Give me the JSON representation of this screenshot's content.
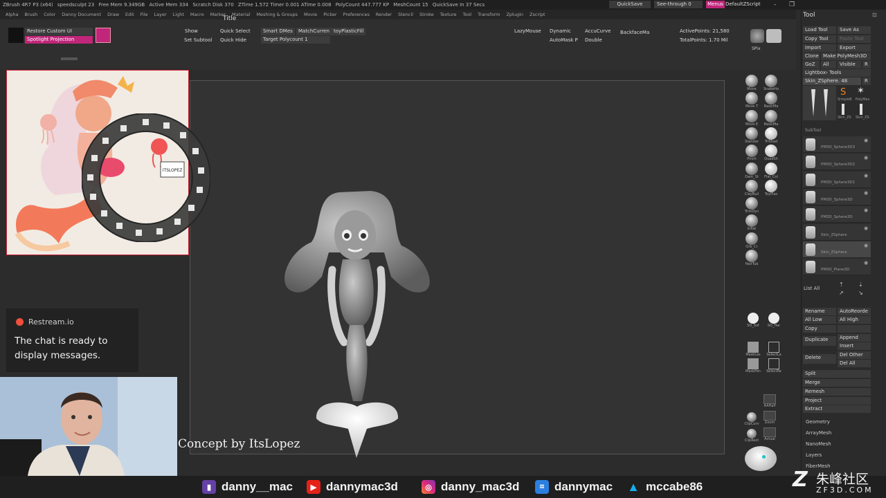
{
  "statusbar": {
    "items": [
      "ZBrush 4R7 P3 (x64)",
      "speedsculpt 23",
      "Free Mem 9.349GB",
      "Active Mem 334",
      "Scratch Disk 370",
      "ZTime 1.572 Timer 0.001 ATime 0.008",
      "PolyCount 447.777 KP",
      "MeshCount 15",
      "QuickSave In 37 Secs"
    ],
    "quicksave": "QuickSave",
    "seethrough": "See-through  0",
    "menus": "Menus",
    "script": "DefaultZScript",
    "window_controls": "- ❐ ✕"
  },
  "menubar": [
    "Alpha",
    "Brush",
    "Color",
    "Danny Document",
    "Draw",
    "Edit",
    "File",
    "Layer",
    "Light",
    "Macro",
    "Marker",
    "Material",
    "Meshing & Groups",
    "Movie",
    "Picker",
    "Preferences",
    "Render",
    "Stencil",
    "Stroke",
    "Texture",
    "Tool",
    "Transform",
    "Zplugin",
    "Zscript"
  ],
  "shelf": {
    "restore": "Restore Custom UI",
    "spotlight": "Spotlight Projection",
    "show": "Show",
    "quick_select": "Quick Select",
    "set_subtool": "Set Subtool",
    "quick_hide": "Quick Hide",
    "smart_dmes": "Smart DMes",
    "match_current": "MatchCurren",
    "toy_plastic": "toyPlasticFill",
    "target_polycount": "Target Polycount 1",
    "lazymouse": "LazyMouse",
    "dynamic": "Dynamic",
    "accucurve": "AccuCurve",
    "backface": "BackfaceMa",
    "automask": "AutoMask P",
    "double": "Double",
    "active_points": "ActivePoints: 21,580",
    "total_points": "TotalPoints: 1.70 Mil",
    "spix": "SPix",
    "title_tip": "Title"
  },
  "right_brushes": [
    {
      "a": "Move",
      "b": "SnakeHo"
    },
    {
      "a": "Move T",
      "b": "BasicMa"
    },
    {
      "a": "Move E",
      "b": "BasicMa"
    },
    {
      "a": "Standar",
      "b": "TriShad"
    },
    {
      "a": "Pinch",
      "b": "QuadSh"
    },
    {
      "a": "Dam_St",
      "b": "Flat_Col"
    },
    {
      "a": "ClayBuil",
      "b": "ToyPlas"
    },
    {
      "a": "TrimDyn",
      "b": ""
    },
    {
      "a": "Inflat",
      "b": ""
    },
    {
      "a": "Orb_Cr",
      "b": ""
    },
    {
      "a": "HairTub",
      "b": ""
    }
  ],
  "right_lower": {
    "so_sof": "SO_Sof",
    "so_har": "SO_Har",
    "masklas": "MaskLas",
    "selectl": "SelectLa",
    "maskpen": "MaskPen",
    "selectr": "SelectRe",
    "aahalf": "AAHalf",
    "clipcurve": "ClipCurv",
    "zoom": "Zoom",
    "cliprect": "ClipRect",
    "actual": "Actual"
  },
  "tool_panel": {
    "title": "Tool",
    "load_tool": "Load Tool",
    "save_as": "Save As",
    "copy_tool": "Copy Tool",
    "paste_tool": "Paste Tool",
    "import": "Import",
    "export": "Export",
    "clone": "Clone",
    "make_polymesh": "Make PolyMesh3D",
    "goz": "GoZ",
    "all": "All",
    "visible": "Visible",
    "r": "R",
    "lightbox_tools": "Lightbox› Tools",
    "current_tool": "Skin_ZSphere. 48",
    "tool_thumbs": [
      "SimpleB",
      "PolyMes",
      "Skin_ZS",
      "Skin_ZS"
    ],
    "subtool_header": "SubTool",
    "subtools": [
      "PM3D_Sphere3D3",
      "PM3D_Sphere3D2",
      "PM3D_Sphere3D1",
      "PM3D_Sphere3D",
      "PM3D_Sphere3D",
      "Skin_ZSphere",
      "Skin_ZSphere",
      "PM3D_Plane3D"
    ],
    "list_all": "List  All",
    "rename": "Rename",
    "auto_reorder": "AutoReorde",
    "all_low": "All Low",
    "all_high": "All High",
    "copy": "Copy",
    "duplicate": "Duplicate",
    "append": "Append",
    "insert": "Insert",
    "delete": "Delete",
    "del_other": "Del Other",
    "del_all": "Del All",
    "split": "Split",
    "merge": "Merge",
    "remesh": "Remesh",
    "project": "Project",
    "extract": "Extract",
    "sections": [
      "Geometry",
      "ArrayMesh",
      "NanoMesh",
      "Layers",
      "FiberMesh"
    ]
  },
  "reference": {
    "logo_text": "ITSLOPEZ"
  },
  "chat": {
    "brand": "Restream.io",
    "message": "The chat is ready to display messages."
  },
  "concept": "Concept by ItsLopez",
  "socials": [
    {
      "name": "twitch-icon",
      "handle": "danny__mac",
      "color": "#6441a5"
    },
    {
      "name": "youtube-icon",
      "handle": "dannymac3d",
      "color": "#e62117"
    },
    {
      "name": "instagram-icon",
      "handle": "danny_mac3d",
      "color": "#c13584"
    },
    {
      "name": "artstation-code-icon",
      "handle": "dannymac",
      "color": "#2b7fe0"
    },
    {
      "name": "artstation-icon",
      "handle": "mccabe86",
      "color": "#13aff0"
    }
  ],
  "watermark": {
    "cn": "朱峰社区",
    "url": "ZF3D.COM"
  },
  "colors": {
    "accent_pink": "#c0267a",
    "panel_bg": "#2b2b2b",
    "canvas_bg": "#333333"
  }
}
